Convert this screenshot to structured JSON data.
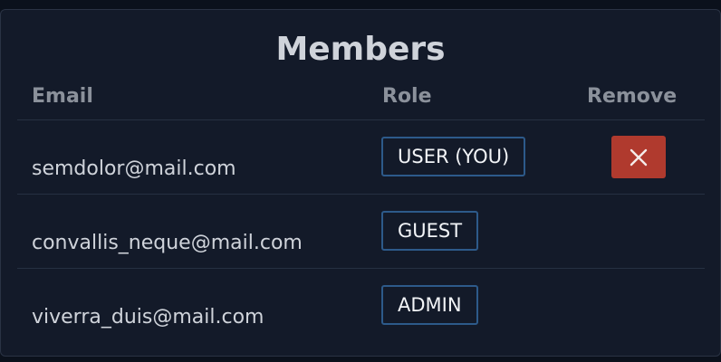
{
  "title": "Members",
  "columns": {
    "email": "Email",
    "role": "Role",
    "remove": "Remove"
  },
  "members": [
    {
      "email": "semdolor@mail.com",
      "role": "USER (YOU)",
      "removable": true,
      "remove_icon": "close-icon"
    },
    {
      "email": "convallis_neque@mail.com",
      "role": "GUEST",
      "removable": false
    },
    {
      "email": "viverra_duis@mail.com",
      "role": "ADMIN",
      "removable": false
    }
  ],
  "colors": {
    "background": "#131a29",
    "role_border": "#2d5a8a",
    "remove_button": "#b03a2e"
  }
}
